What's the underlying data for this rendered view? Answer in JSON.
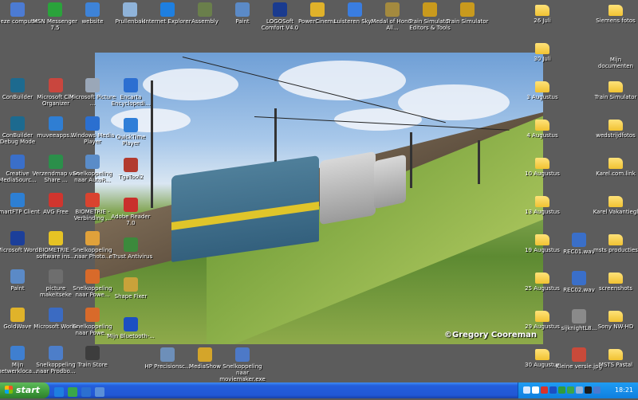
{
  "wallpaper": {
    "copyright": "©Gregory Cooreman"
  },
  "icons_top": [
    {
      "label": "Deze computer",
      "icon": "computer-icon",
      "color": "#4c7bd3"
    },
    {
      "label": "MSN Messenger 7.5",
      "icon": "msn-messenger-icon",
      "color": "#2aa33b"
    },
    {
      "label": "website",
      "icon": "website-icon",
      "color": "#3e83d8"
    },
    {
      "label": "Prullenbak",
      "icon": "recycle-bin-icon",
      "color": "#8fb3d9"
    },
    {
      "label": "Internet Explorer",
      "icon": "internet-explorer-icon",
      "color": "#1e7fe0"
    },
    {
      "label": "Assembly",
      "icon": "assembly-icon",
      "color": "#6a7f4b"
    },
    {
      "label": "Paint",
      "icon": "paint-icon",
      "color": "#5b8ac7"
    },
    {
      "label": "LOGOSoft Comfort V4.0",
      "icon": "logosoft-icon",
      "color": "#1a3b8f"
    },
    {
      "label": "PowerCinema",
      "icon": "powercinema-icon",
      "color": "#e0b22a"
    },
    {
      "label": "Luisteren Sky...",
      "icon": "msn-icon",
      "color": "#3a7de0"
    },
    {
      "label": "Medal of Honor All...",
      "icon": "medal-icon",
      "color": "#a48a3e"
    },
    {
      "label": "Train Simulator Editors & Tools",
      "icon": "train-simulator-icon",
      "color": "#c99a1d"
    },
    {
      "label": "Train Simulator",
      "icon": "train-simulator-icon",
      "color": "#c99a1d"
    }
  ],
  "icons_left_col1": [
    {
      "label": "ConBuilder",
      "icon": "conbuilder-icon",
      "color": "#1d6a8f"
    },
    {
      "label": "ConBuilder Debug Mode",
      "icon": "conbuilder-icon",
      "color": "#1d6a8f"
    },
    {
      "label": "Creative MediaSourc...",
      "icon": "creative-icon",
      "color": "#3a6fc9"
    },
    {
      "label": "SmartFTP Client",
      "icon": "ftp-icon",
      "color": "#2d7fd3"
    },
    {
      "label": "Microsoft Word",
      "icon": "word-icon",
      "color": "#1c3f9a"
    },
    {
      "label": "Paint",
      "icon": "paint-icon",
      "color": "#5b8ac7"
    },
    {
      "label": "GoldWave",
      "icon": "goldwave-icon",
      "color": "#e0b32a"
    },
    {
      "label": "Mijn netwerkloca...",
      "icon": "network-icon",
      "color": "#3f7fd0"
    }
  ],
  "icons_left_col2": [
    {
      "label": "Microsoft Clip Organizer",
      "icon": "clip-organizer-icon",
      "color": "#c9463e"
    },
    {
      "label": "muveeapps...",
      "icon": "muvee-icon",
      "color": "#2f7ed3"
    },
    {
      "label": "Verzendmap van Share ...",
      "icon": "share-icon",
      "color": "#2b8f4a"
    },
    {
      "label": "AVG Free",
      "icon": "avg-icon",
      "color": "#d0352e"
    },
    {
      "label": "BIOMETRIE - software ins...",
      "icon": "key-icon",
      "color": "#e6c324"
    },
    {
      "label": "picture makeitseke",
      "icon": "picture-icon",
      "color": "#6e6e6e"
    },
    {
      "label": "Microsoft Works",
      "icon": "works-icon",
      "color": "#3b6bc2"
    },
    {
      "label": "Snelkoppeling naar Prodbo...",
      "icon": "shortcut-icon",
      "color": "#4d7ec9"
    }
  ],
  "icons_left_col3": [
    {
      "label": "Microsoft Picture ...",
      "icon": "picture-icon",
      "color": "#9aa7b8"
    },
    {
      "label": "Windows Media Player",
      "icon": "media-player-icon",
      "color": "#2b6fd0"
    },
    {
      "label": "Snelkoppeling naar AutoR...",
      "icon": "shortcut-icon",
      "color": "#5a8cc8"
    },
    {
      "label": "BIOMETRIE - Verbinding ...",
      "icon": "biometrie-icon",
      "color": "#d9432f"
    },
    {
      "label": "Snelkoppeling naar Photo...",
      "icon": "shortcut-icon",
      "color": "#e0a13a"
    },
    {
      "label": "Snelkoppeling naar Powe...",
      "icon": "shortcut-icon",
      "color": "#d86a2a"
    },
    {
      "label": "Snelkoppeling naar Powe...",
      "icon": "shortcut-icon",
      "color": "#d86a2a"
    },
    {
      "label": "Train Store",
      "icon": "train-store-icon",
      "color": "#3d3d3d"
    }
  ],
  "icons_left_col4": [
    {
      "label": "Encarta Encyclopedi...",
      "icon": "encarta-icon",
      "color": "#2c6fd1"
    },
    {
      "label": "QuickTime Player",
      "icon": "quicktime-icon",
      "color": "#2f7ed8"
    },
    {
      "label": "TgaTool2",
      "icon": "tgatool-icon",
      "color": "#b23a2f"
    },
    {
      "label": "Adobe Reader 7.0",
      "icon": "adobe-reader-icon",
      "color": "#c9302c"
    },
    {
      "label": "eTrust Antivirus",
      "icon": "antivirus-icon",
      "color": "#3c8a3c"
    },
    {
      "label": "Shape Fixer",
      "icon": "shape-fixer-icon",
      "color": "#c9a23a"
    },
    {
      "label": "Mijn Bluetooth-...",
      "icon": "bluetooth-icon",
      "color": "#1c4fc2"
    }
  ],
  "icons_bottom_extra": [
    {
      "label": "HP Precisionsc...",
      "icon": "scanner-icon",
      "color": "#6d8fb9"
    },
    {
      "label": "MediaShow",
      "icon": "mediashow-icon",
      "color": "#d4a52a"
    },
    {
      "label": "Snelkoppeling naar moviemaker.exe",
      "icon": "moviemaker-icon",
      "color": "#4d79c7"
    }
  ],
  "icons_right_col1": [
    {
      "label": "26 Juli",
      "icon": "folder-icon"
    },
    {
      "label": "30 Juli",
      "icon": "folder-icon"
    },
    {
      "label": "3 Augustus",
      "icon": "folder-icon"
    },
    {
      "label": "4 Augustus",
      "icon": "folder-icon"
    },
    {
      "label": "10 Augustus",
      "icon": "folder-icon"
    },
    {
      "label": "13 Augustus",
      "icon": "folder-icon"
    },
    {
      "label": "19 Augustus",
      "icon": "folder-icon"
    },
    {
      "label": "25 Augustus",
      "icon": "folder-icon"
    },
    {
      "label": "29 Augustus",
      "icon": "folder-icon"
    },
    {
      "label": "30 Augustus",
      "icon": "folder-icon"
    }
  ],
  "icons_right_col2": [
    {
      "label": "REC01.wav",
      "icon": "wav-icon",
      "color": "#3a6fc9"
    },
    {
      "label": "REC02.wav",
      "icon": "wav-icon",
      "color": "#3a6fc9"
    },
    {
      "label": "sijknightL8...",
      "icon": "image-file-icon",
      "color": "#8a8a8a"
    },
    {
      "label": "Kleine versie.jpg",
      "icon": "image-file-icon",
      "color": "#c94a3a"
    }
  ],
  "icons_right_col3": [
    {
      "label": "Siemens fotos",
      "icon": "folder-icon"
    },
    {
      "label": "Mijn documenten",
      "icon": "my-documents-icon"
    },
    {
      "label": "Train Simulator",
      "icon": "folder-icon"
    },
    {
      "label": "wedstrijdfotos",
      "icon": "folder-icon"
    },
    {
      "label": "Karel.com.link",
      "icon": "folder-icon"
    },
    {
      "label": "Karel Vakantiegl",
      "icon": "folder-icon"
    },
    {
      "label": "msts producties",
      "icon": "folder-icon"
    },
    {
      "label": "screenshots",
      "icon": "folder-icon"
    },
    {
      "label": "Sony NW-HD",
      "icon": "folder-icon"
    },
    {
      "label": "MSTS Pastal",
      "icon": "folder-icon"
    }
  ],
  "taskbar": {
    "start_label": "start",
    "clock": "18:21",
    "quicklaunch": [
      {
        "icon": "internet-explorer-icon",
        "color": "#1e7fe0"
      },
      {
        "icon": "msn-icon",
        "color": "#3aa64a"
      },
      {
        "icon": "media-player-icon",
        "color": "#2b6fd0"
      },
      {
        "icon": "show-desktop-icon",
        "color": "#5a8fd8"
      }
    ],
    "tray": [
      {
        "icon": "network-tray-icon",
        "color": "#d7e8ff"
      },
      {
        "icon": "volume-tray-icon",
        "color": "#ffffff"
      },
      {
        "icon": "security-tray-icon",
        "color": "#d9332a"
      },
      {
        "icon": "bluetooth-tray-icon",
        "color": "#1c4fc2"
      },
      {
        "icon": "antivirus-tray-icon",
        "color": "#2f9c3d"
      },
      {
        "icon": "msn-tray-icon",
        "color": "#3aa64a"
      },
      {
        "icon": "safely-remove-tray-icon",
        "color": "#9ab3d6"
      },
      {
        "icon": "app-tray-icon",
        "color": "#1b1b1b"
      },
      {
        "icon": "monitor-tray-icon",
        "color": "#4a7ad0"
      }
    ]
  }
}
